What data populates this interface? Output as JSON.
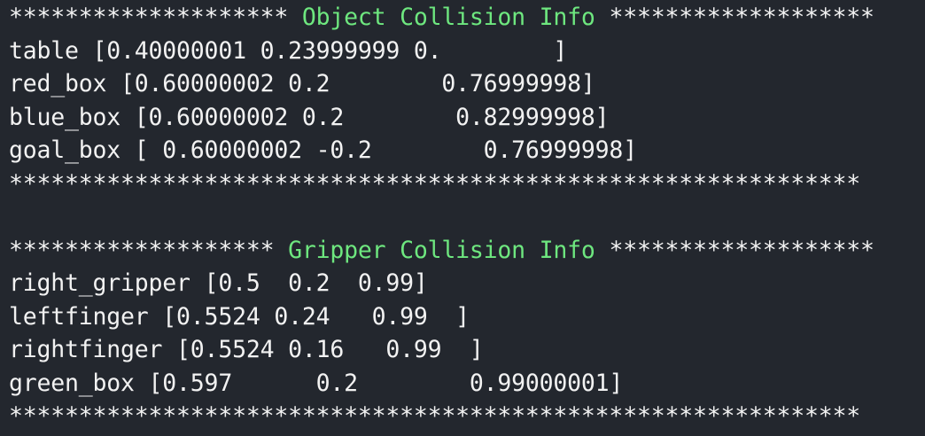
{
  "object_section": {
    "prefix": "******************** ",
    "title": "Object Collision Info",
    "suffix": " *******************",
    "rows": [
      "table [0.40000001 0.23999999 0.        ]",
      "red_box [0.60000002 0.2        0.76999998]",
      "blue_box [0.60000002 0.2        0.82999998]",
      "goal_box [ 0.60000002 -0.2        0.76999998]"
    ],
    "footer": "*************************************************************"
  },
  "blank_line": "",
  "gripper_section": {
    "prefix": "******************* ",
    "title": "Gripper Collision Info",
    "suffix": " *******************",
    "rows": [
      "right_gripper [0.5  0.2  0.99]",
      "leftfinger [0.5524 0.24   0.99  ]",
      "rightfinger [0.5524 0.16   0.99  ]",
      "green_box [0.597      0.2        0.99000001]"
    ],
    "footer": "*************************************************************"
  }
}
